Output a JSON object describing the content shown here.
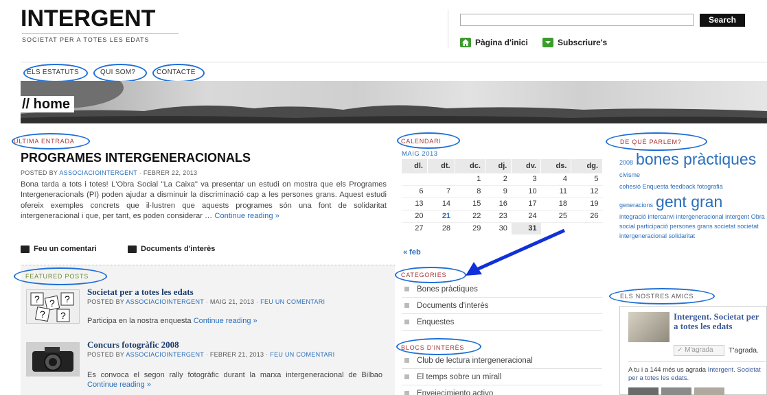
{
  "header": {
    "site_title": "INTERGENT",
    "tagline": "SOCIETAT PER A TOTES LES EDATS",
    "search_button": "Search",
    "home_link": "Pàgina d'inici",
    "subscribe_link": "Subscriure's"
  },
  "nav": {
    "items": [
      "ELS ESTATUTS",
      "QUI SOM?",
      "CONTACTE"
    ]
  },
  "banner": {
    "title": "// home"
  },
  "latest": {
    "section_label": "ÚLTIMA ENTRADA",
    "title": "PROGRAMES INTERGENERACIONALS",
    "meta_prefix": "POSTED BY ",
    "author": "ASSOCIACIOINTERGENT",
    "meta_date": " · FEBRER 22, 2013",
    "body": "Bona tarda a tots i totes! L'Obra Social \"La Caixa\" va presentar un estudi on mostra que els Programes Intergeneracionals (PI) poden ajudar a disminuir la discriminació cap a les persones grans. Aquest estudi ofereix exemples concrets que il·lustren que aquests programes són una font de solidaritat intergeneracional i que, per tant, es poden considerar … ",
    "continue": "Continue reading »",
    "comment_link": "Feu un comentari",
    "docs_link": "Documents d'interès"
  },
  "featured": {
    "section_label": "FEATURED POSTS",
    "posts": [
      {
        "title": "Societat per a totes les edats",
        "meta_prefix": "POSTED BY ",
        "author": "ASSOCIACIOINTERGENT",
        "meta_date": " · MAIG 21, 2013 · ",
        "comment": "FEU UN COMENTARI",
        "excerpt": "Participa en la nostra enquesta ",
        "continue": "Continue reading »"
      },
      {
        "title": "Concurs fotogràfic 2008",
        "meta_prefix": "POSTED BY ",
        "author": "ASSOCIACIOINTERGENT",
        "meta_date": " · FEBRER 21, 2013 · ",
        "comment": "FEU UN COMENTARI",
        "excerpt": "Es convoca el segon rally fotogràfic durant la marxa intergeneracional de Bilbao ",
        "continue": "Continue reading »"
      }
    ]
  },
  "calendar": {
    "section_label": "CALENDARI",
    "month": "MAIG 2013",
    "days": [
      "dl.",
      "dt.",
      "dc.",
      "dj.",
      "dv.",
      "ds.",
      "dg."
    ],
    "weeks": [
      [
        "",
        "",
        "1",
        "2",
        "3",
        "4",
        "5"
      ],
      [
        "6",
        "7",
        "8",
        "9",
        "10",
        "11",
        "12"
      ],
      [
        "13",
        "14",
        "15",
        "16",
        "17",
        "18",
        "19"
      ],
      [
        "20",
        "21",
        "22",
        "23",
        "24",
        "25",
        "26"
      ],
      [
        "27",
        "28",
        "29",
        "30",
        "31",
        "",
        ""
      ]
    ],
    "linked_day": "21",
    "today": "31",
    "prev_link": "« feb"
  },
  "categories": {
    "section_label": "CATEGORIES",
    "items": [
      "Bones pràctiques",
      "Documents d'interès",
      "Enquestes"
    ]
  },
  "blocs": {
    "section_label": "BLOCS D'INTERÈS",
    "items": [
      "Club de lectura intergeneracional",
      "El temps sobre un mirall",
      "Envejecimiento activo"
    ]
  },
  "tags": {
    "section_label": "DE QUÈ PARLEM?",
    "items": [
      "2008",
      "bones pràctiques",
      "civisme",
      "cohesió",
      "Enquesta",
      "feedback",
      "fotografia",
      "generacions",
      "gent gran",
      "integració",
      "intercanvi intergeneracional",
      "intergent",
      "Obra social",
      "participació",
      "persones grans",
      "societat",
      "societat intergeneracional",
      "solidaritat"
    ]
  },
  "friends": {
    "section_label": "ELS NOSTRES AMICS",
    "page_name": "Intergent. Societat per a totes les edats",
    "like_button": "M'agrada",
    "like_text": "T'agrada.",
    "fans_text": "A tu i a 144 més us agrada ",
    "fans_link": "Intergent. Societat per a totes les edats."
  },
  "colors": {
    "accent_link": "#2a6ebb",
    "annotation_blue": "#1f6fd6",
    "green_icon": "#3b9c2c",
    "label_red": "#a33"
  }
}
